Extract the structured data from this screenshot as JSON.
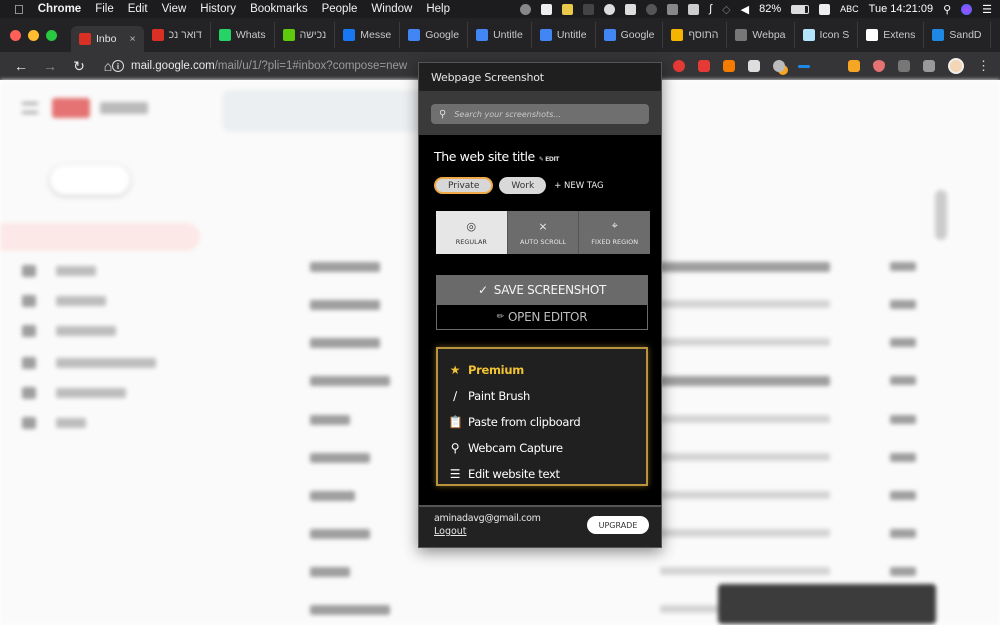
{
  "menubar": {
    "apple_icon": "apple-icon",
    "app": "Chrome",
    "items": [
      "File",
      "Edit",
      "View",
      "History",
      "Bookmarks",
      "People",
      "Window",
      "Help"
    ],
    "battery": "82%",
    "input_source": "ABC",
    "clock": "Tue 14:21:09"
  },
  "tabs": [
    {
      "label": "Inbo",
      "icon": "gmail-icon",
      "color": "#d93025",
      "active": true
    },
    {
      "label": "דואר נכ",
      "icon": "gmail-icon",
      "color": "#d93025"
    },
    {
      "label": "Whats",
      "icon": "whatsapp-icon",
      "color": "#25d366"
    },
    {
      "label": "נכישה",
      "icon": "green-app-icon",
      "color": "#5fc90b"
    },
    {
      "label": "Messe",
      "icon": "messenger-icon",
      "color": "#1877f2"
    },
    {
      "label": "Google",
      "icon": "google-translate-icon",
      "color": "#4285f4"
    },
    {
      "label": "Untitle",
      "icon": "google-docs-icon",
      "color": "#4285f4"
    },
    {
      "label": "Untitle",
      "icon": "google-docs-icon",
      "color": "#4285f4"
    },
    {
      "label": "Google",
      "icon": "google-translate-icon",
      "color": "#4285f4"
    },
    {
      "label": "התוסף",
      "icon": "google-slides-icon",
      "color": "#f4b400"
    },
    {
      "label": "Webpa",
      "icon": "webpage-icon",
      "color": "#777777"
    },
    {
      "label": "Icon S",
      "icon": "icon-search-icon",
      "color": "#b3e5fc"
    },
    {
      "label": "Extens",
      "icon": "puzzle-icon",
      "color": "#ffffff"
    },
    {
      "label": "SandD",
      "icon": "sand-icon",
      "color": "#1e88e5"
    }
  ],
  "omnibox": {
    "host": "mail.google.com",
    "path": "/mail/u/1/?pli=1#inbox?compose=new"
  },
  "popup": {
    "title": "Webpage Screenshot",
    "search_placeholder": "Search your screenshots...",
    "site_title": "The web site title",
    "edit_label": "EDIT",
    "tags": [
      {
        "label": "Private",
        "selected": true
      },
      {
        "label": "Work",
        "selected": false
      }
    ],
    "new_tag": "+ NEW TAG",
    "modes": [
      {
        "label": "REGULAR",
        "icon": "target-icon",
        "selected": true
      },
      {
        "label": "AUTO SCROLL",
        "icon": "expand-vertical-icon",
        "selected": false
      },
      {
        "label": "FIXED REGION",
        "icon": "crop-icon",
        "selected": false
      }
    ],
    "save_label": "SAVE SCREENSHOT",
    "editor_label": "OPEN EDITOR",
    "premium": {
      "title": "Premium",
      "items": [
        {
          "label": "Paint Brush",
          "icon": "brush-icon"
        },
        {
          "label": "Paste from clipboard",
          "icon": "clipboard-icon"
        },
        {
          "label": "Webcam Capture",
          "icon": "webcam-icon"
        },
        {
          "label": "Edit website text",
          "icon": "text-edit-icon"
        }
      ]
    },
    "account_email": "aminadavg@gmail.com",
    "logout": "Logout",
    "upgrade": "UPGRADE"
  },
  "colors": {
    "premium_gold": "#f1c232",
    "tag_selected_border": "#f0a848"
  }
}
